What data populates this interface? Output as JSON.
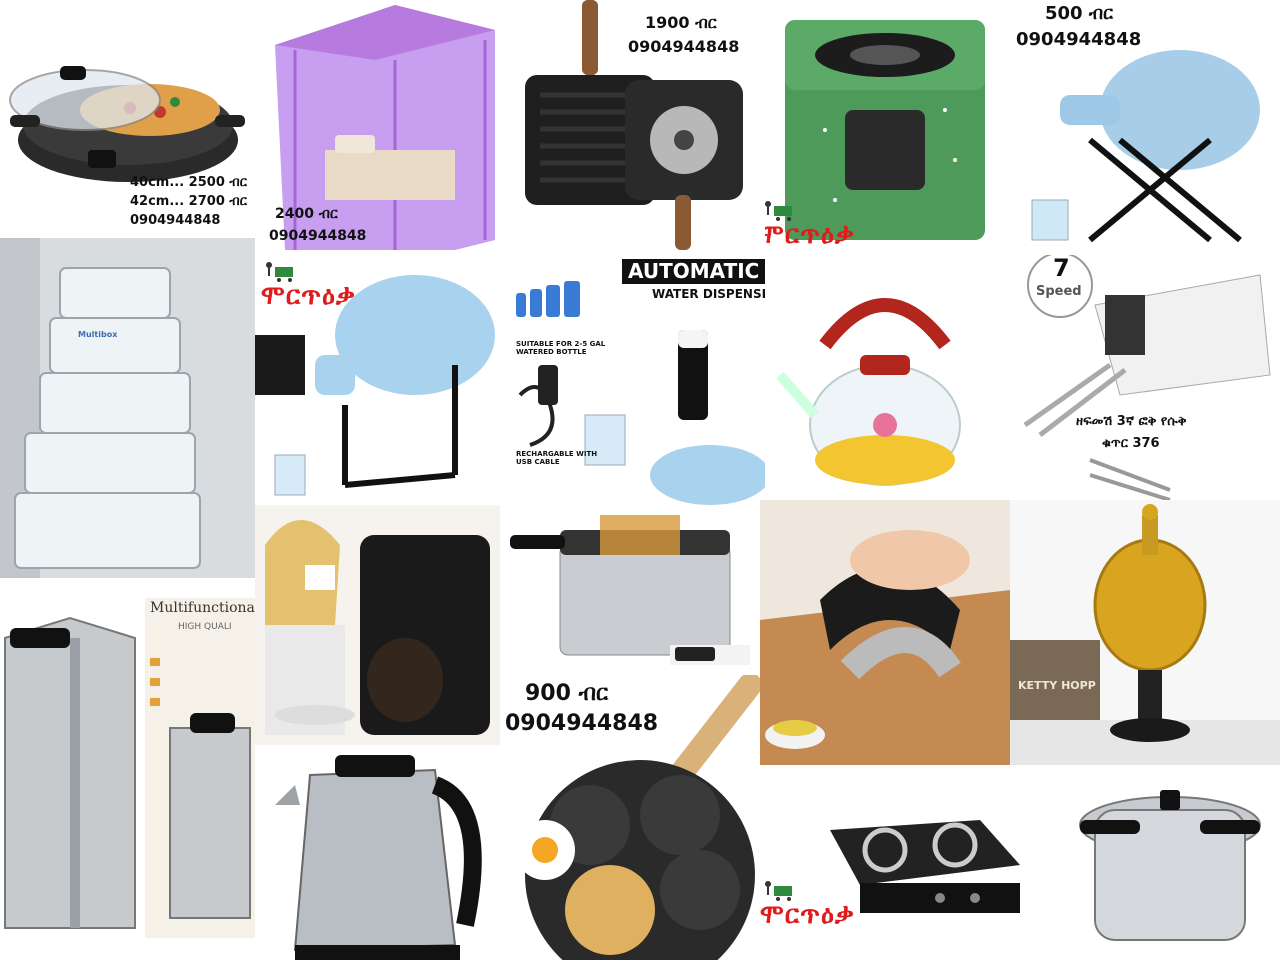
{
  "colors": {
    "brand_red": "#e01b1b",
    "price_text": "#111111",
    "net_purple": "#b77be0",
    "stove_green": "#4e9a5a",
    "water_blue": "#9dc8e6",
    "kettle_red": "#b3261e"
  },
  "brand": {
    "logo_text": "ሞርጥዕቃ",
    "icon": "delivery-cart-icon"
  },
  "tiles": {
    "pizza_pan": {
      "price_line1": "40cm... 2500 ብር",
      "price_line2": "42cm... 2700 ብር",
      "phone": "0904944848"
    },
    "mosquito_net": {
      "price": "2400 ብር",
      "phone": "0904944848"
    },
    "grill_pan": {
      "price": "1900 ብር",
      "phone": "0904944848"
    },
    "kerosene_stove": {},
    "bottle_stand": {
      "price": "500 ብር",
      "phone": "0904944848"
    },
    "storage_boxes": {
      "box_label": "Multibox"
    },
    "water_stand": {},
    "water_pump": {
      "title_line1": "AUTOMATIC",
      "title_line2": "WATER DISPENSER",
      "note_bottle": "SUITABLE FOR 2-5 GAL\nWATERED BOTTLE",
      "note_usb": "RECHARGABLE WITH\nUSB CABLE"
    },
    "glass_kettle": {},
    "hand_mixer": {
      "speed_number": "7",
      "speed_label": "Speed",
      "caption_line1": "ዘፍመሽ 3ኛ ፎቅ የሱቅ",
      "caption_line2": "ቁጥር 376"
    },
    "coffee_maker": {},
    "deep_fryer": {},
    "garlic_press": {},
    "incense_burner": {
      "book_text": "KETTY HOPP"
    },
    "box_grater": {
      "box_title": "Multifunctiona",
      "box_subtitle": "HIGH QUALI"
    },
    "electric_kettle": {},
    "egg_pan": {
      "price": "900 ብር",
      "phone": "0904944848"
    },
    "hot_plate": {},
    "pressure_cooker": {}
  }
}
